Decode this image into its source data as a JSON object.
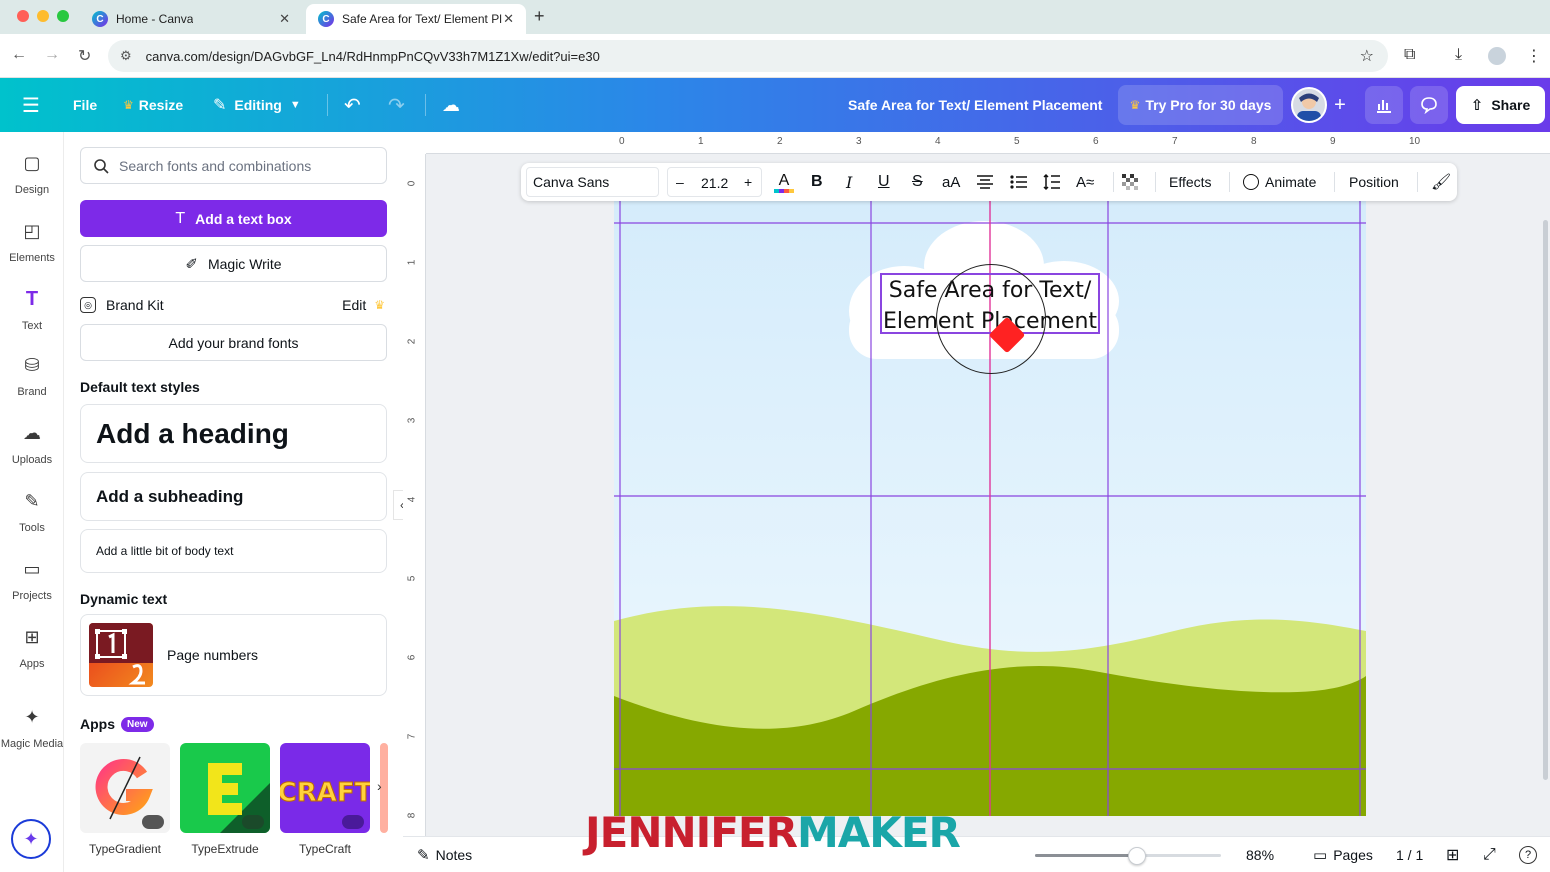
{
  "browser": {
    "tabs": [
      {
        "title": "Home - Canva",
        "active": false
      },
      {
        "title": "Safe Area for Text/ Element Pl",
        "active": true
      }
    ],
    "url": "canva.com/design/DAGvbGF_Ln4/RdHnmpPnCQvV33h7M1Z1Xw/edit?ui=e30"
  },
  "header": {
    "file_label": "File",
    "resize_label": "Resize",
    "editing_label": "Editing",
    "design_title": "Safe Area for Text/ Element Placement",
    "try_pro_label": "Try Pro for 30 days",
    "share_label": "Share"
  },
  "rail": [
    {
      "label": "Design",
      "icon": "design-icon",
      "glyph": "▢"
    },
    {
      "label": "Elements",
      "icon": "elements-icon",
      "glyph": "◰"
    },
    {
      "label": "Text",
      "icon": "text-icon",
      "glyph": "T"
    },
    {
      "label": "Brand",
      "icon": "brand-icon",
      "glyph": "⛁"
    },
    {
      "label": "Uploads",
      "icon": "uploads-icon",
      "glyph": "☁"
    },
    {
      "label": "Tools",
      "icon": "tools-icon",
      "glyph": "✎"
    },
    {
      "label": "Projects",
      "icon": "projects-icon",
      "glyph": "▭"
    },
    {
      "label": "Apps",
      "icon": "apps-icon",
      "glyph": "⊞"
    },
    {
      "label": "Magic Media",
      "icon": "magic-media-icon",
      "glyph": "✦"
    }
  ],
  "panel": {
    "search_placeholder": "Search fonts and combinations",
    "add_text_box": "Add a text box",
    "magic_write": "Magic Write",
    "brand_kit": "Brand Kit",
    "brand_edit": "Edit",
    "add_brand_fonts": "Add your brand fonts",
    "default_styles_title": "Default text styles",
    "heading": "Add a heading",
    "subheading": "Add a subheading",
    "body": "Add a little bit of body text",
    "dynamic_title": "Dynamic text",
    "page_numbers": "Page numbers",
    "apps_title": "Apps",
    "apps_badge": "New",
    "apps": [
      {
        "name": "TypeGradient"
      },
      {
        "name": "TypeExtrude"
      },
      {
        "name": "TypeCraft"
      }
    ]
  },
  "toolbar": {
    "font": "Canva Sans",
    "minus": "–",
    "size": "21.2",
    "plus": "+",
    "bold": "B",
    "italic": "I",
    "underline": "U",
    "strike": "S",
    "case": "aA",
    "effects": "Effects",
    "animate": "Animate",
    "position": "Position"
  },
  "ruler": {
    "h_ticks": [
      "0",
      "1",
      "2",
      "3",
      "4",
      "5",
      "6",
      "7",
      "8",
      "9",
      "10"
    ],
    "v_ticks": [
      "0",
      "1",
      "2",
      "3",
      "4",
      "5",
      "6",
      "7",
      "8"
    ]
  },
  "canvas": {
    "text_line1": "Safe Area for Text/",
    "text_line2": "Element Placement",
    "sky_top": "#d5ecfb",
    "sky_bottom": "#eaf6fe",
    "hill_light": "#d3e77a",
    "hill_dark": "#86a800",
    "guide_color": "#8a45e0"
  },
  "bottom": {
    "notes": "Notes",
    "zoom": "88%",
    "pages": "Pages",
    "page_count": "1 / 1"
  },
  "watermark": {
    "part1": "JENNIFER",
    "part2": "MAKER"
  },
  "colors": {
    "accent_purple": "#7d2ae8",
    "header_start": "#00c2cc",
    "header_end": "#6a3bea"
  }
}
